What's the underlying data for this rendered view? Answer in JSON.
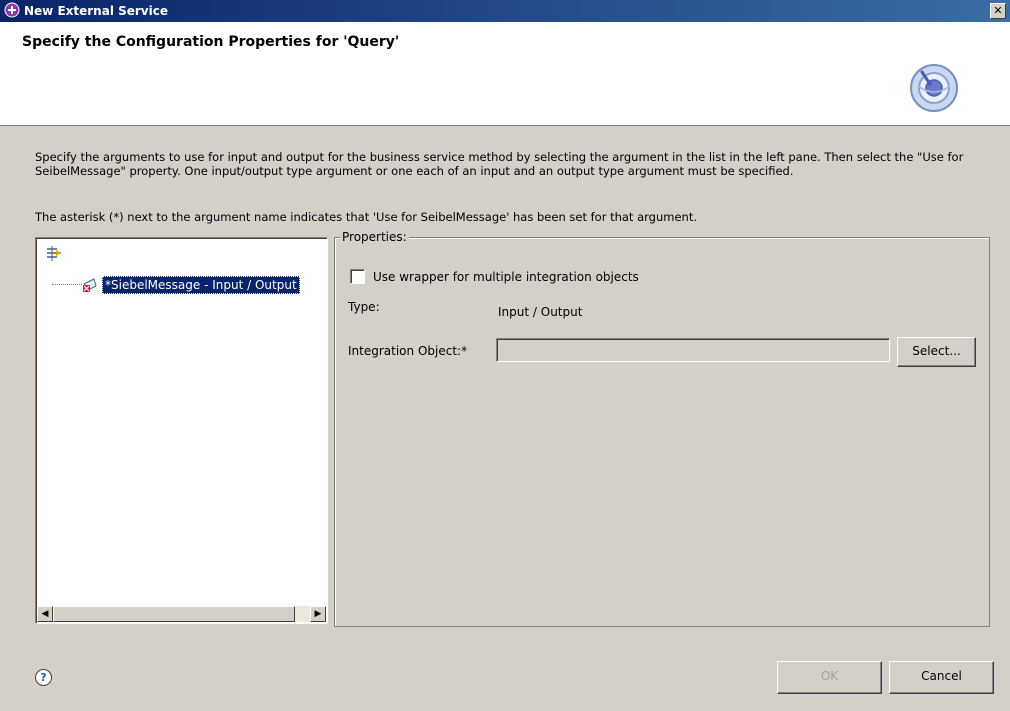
{
  "window": {
    "title": "New External Service",
    "close_glyph": "✕"
  },
  "header": {
    "title": "Specify the Configuration Properties for 'Query'"
  },
  "description": {
    "line1": "Specify the arguments to use for input and output for the business service method by selecting the argument in the list in the left pane. Then select the \"Use for SeibelMessage\" property. One input/output type argument or one each of an input and an output type argument must be specified.",
    "line2": "The asterisk (*) next to the argument name indicates that 'Use for SeibelMessage' has been set for that argument."
  },
  "tree": {
    "items": [
      {
        "label": "*SiebelMessage - Input / Output"
      }
    ],
    "scroll_left": "◀",
    "scroll_right": "▶"
  },
  "properties": {
    "group_label": "Properties:",
    "wrapper_checkbox_label": "Use wrapper for multiple integration objects",
    "type_label": "Type:",
    "type_value": "Input / Output",
    "integration_object_label": "Integration Object:*",
    "integration_object_value": "",
    "select_button": "Select..."
  },
  "buttons": {
    "help": "?",
    "ok": "OK",
    "cancel": "Cancel"
  },
  "colors": {
    "titlebar": "#0a246a",
    "selection": "#0a246a",
    "dialog_bg": "#d4d0c8"
  }
}
